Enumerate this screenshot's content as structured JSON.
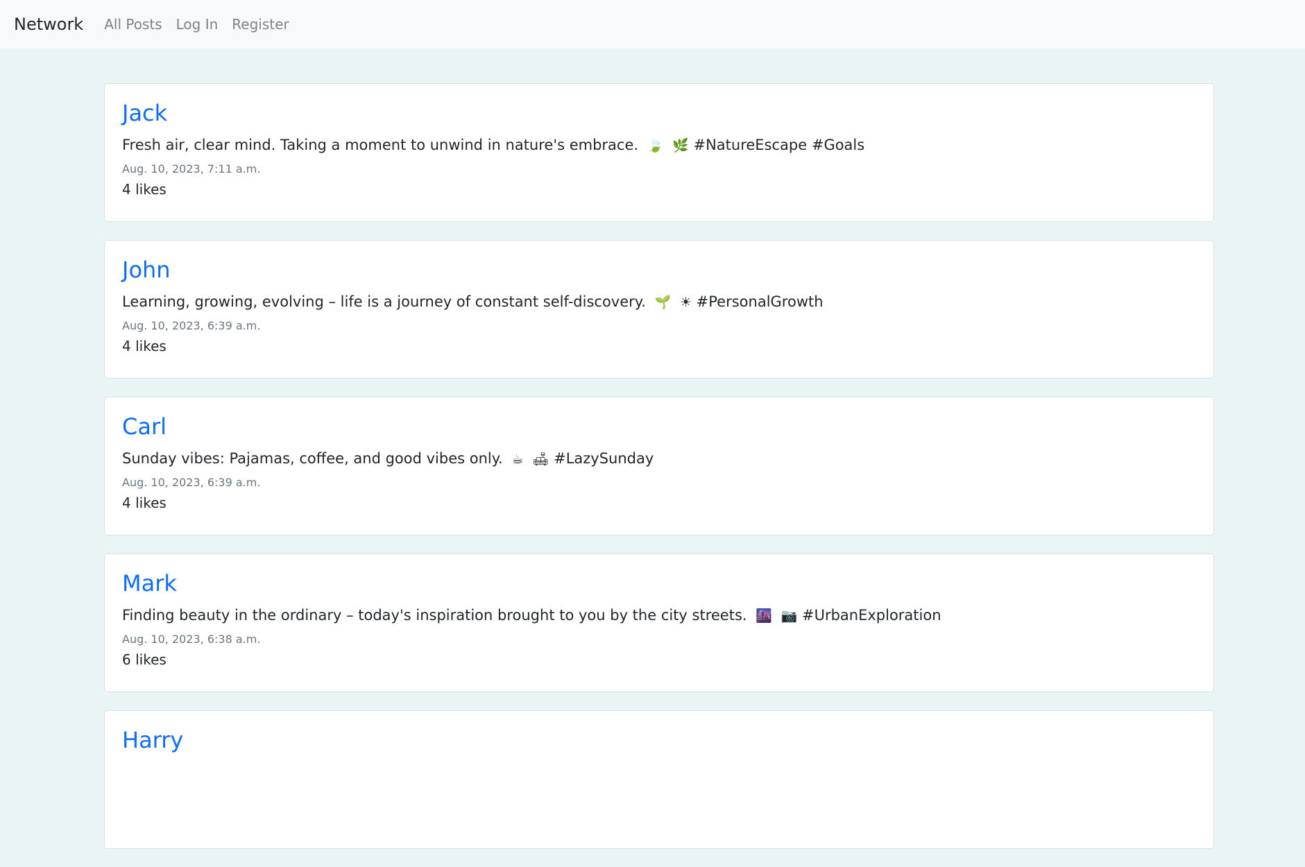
{
  "nav": {
    "brand": "Network",
    "links": [
      "All Posts",
      "Log In",
      "Register"
    ]
  },
  "posts": [
    {
      "author": "Jack",
      "text": "Fresh air, clear mind. Taking a moment to unwind in nature's embrace.",
      "emojis": [
        "🍃",
        "🌿"
      ],
      "tags": "#NatureEscape #Goals",
      "timestamp": "Aug. 10, 2023, 7:11 a.m.",
      "likes": "4 likes"
    },
    {
      "author": "John",
      "text": "Learning, growing, evolving – life is a journey of constant self-discovery.",
      "emojis": [
        "🌱",
        "☀"
      ],
      "tags": "#PersonalGrowth",
      "timestamp": "Aug. 10, 2023, 6:39 a.m.",
      "likes": "4 likes"
    },
    {
      "author": "Carl",
      "text": "Sunday vibes: Pajamas, coffee, and good vibes only.",
      "emojis": [
        "☕",
        "🛋"
      ],
      "tags": "#LazySunday",
      "timestamp": "Aug. 10, 2023, 6:39 a.m.",
      "likes": "4 likes"
    },
    {
      "author": "Mark",
      "text": "Finding beauty in the ordinary – today's inspiration brought to you by the city streets.",
      "emojis": [
        "🌆",
        "📷"
      ],
      "tags": "#UrbanExploration",
      "timestamp": "Aug. 10, 2023, 6:38 a.m.",
      "likes": "6 likes"
    },
    {
      "author": "Harry"
    }
  ]
}
